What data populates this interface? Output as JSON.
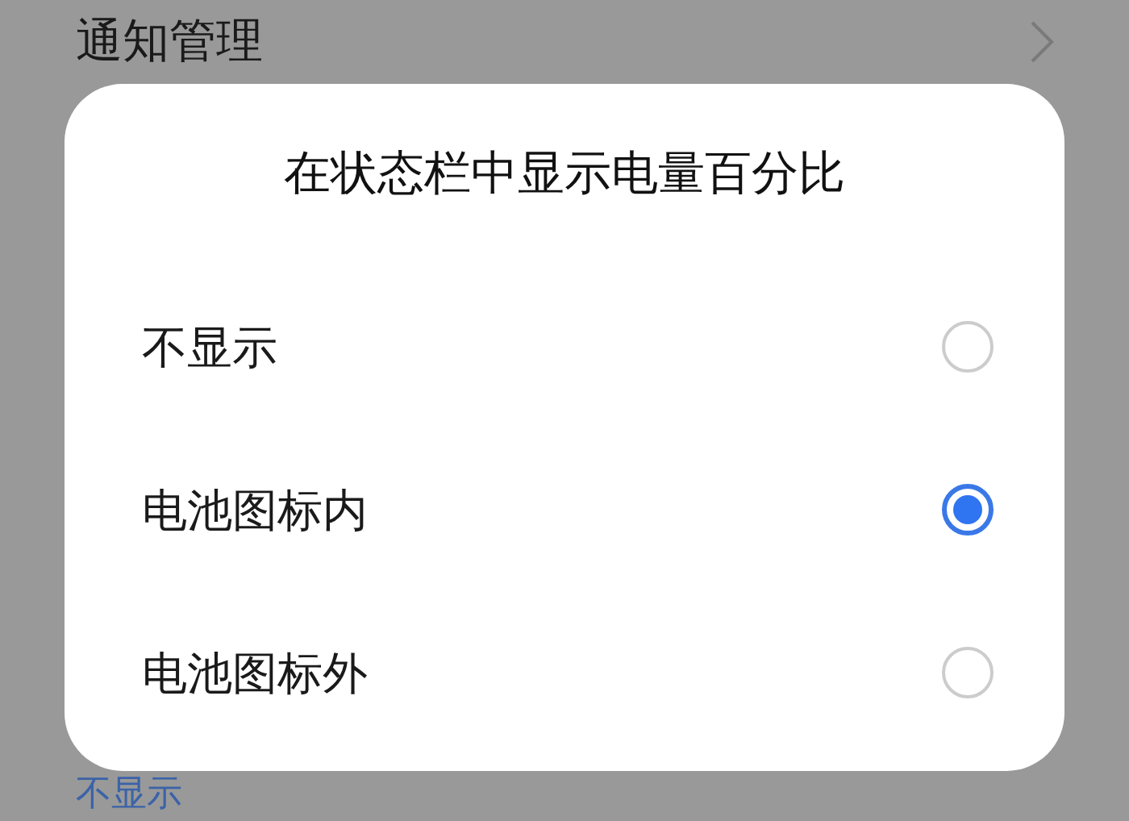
{
  "background": {
    "row_label": "通知管理",
    "footer_value": "不显示"
  },
  "dialog": {
    "title": "在状态栏中显示电量百分比",
    "options": [
      {
        "label": "不显示",
        "selected": false
      },
      {
        "label": "电池图标内",
        "selected": true
      },
      {
        "label": "电池图标外",
        "selected": false
      }
    ]
  }
}
